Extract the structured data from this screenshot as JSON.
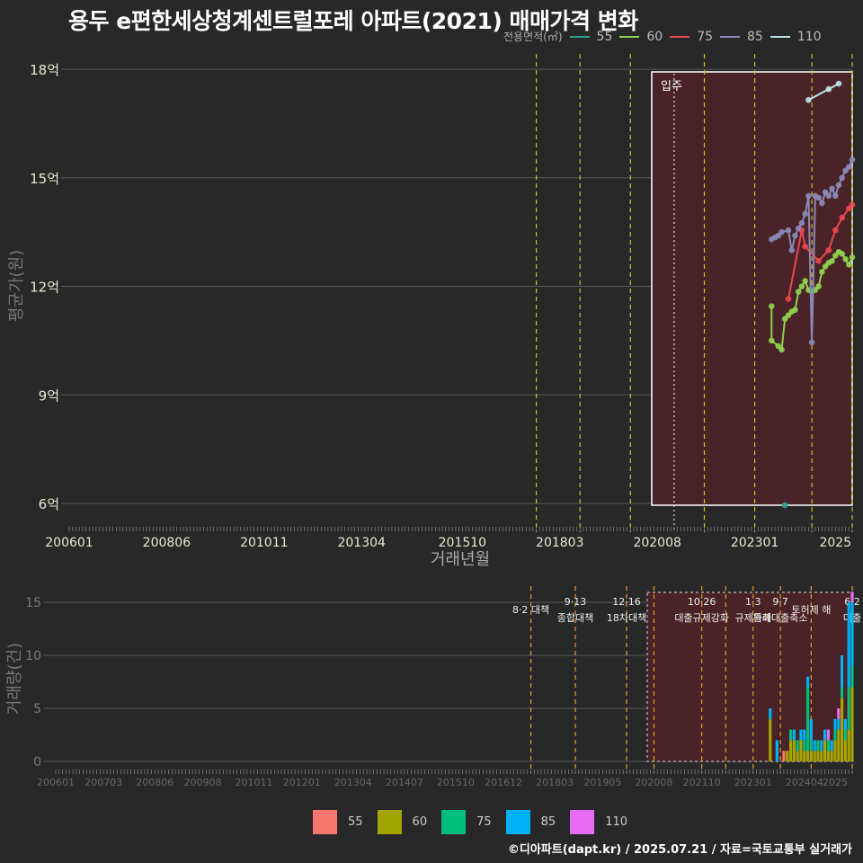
{
  "title": "용두 e편한세상청계센트럴포레 아파트(2021) 매매가격 변화",
  "footer": "©디아파트(dapt.kr) / 2025.07.21 / 자료=국토교통부 실거래가",
  "legend_title": "전용면적(㎡)",
  "legend": [
    {
      "name": "55",
      "line_color": "#2e9e96",
      "bar_color": "#f8766d"
    },
    {
      "name": "60",
      "line_color": "#8fd14f",
      "bar_color": "#a3a500"
    },
    {
      "name": "75",
      "line_color": "#e8484e",
      "bar_color": "#00bf7d"
    },
    {
      "name": "85",
      "line_color": "#8a89b8",
      "bar_color": "#00b0f6"
    },
    {
      "name": "110",
      "line_color": "#bde3ea",
      "bar_color": "#e76bf3"
    }
  ],
  "chart_data": [
    {
      "type": "line",
      "title": "용두 e편한세상청계센트럴포레 아파트(2021) 매매가격 변화",
      "xlabel": "거래년월",
      "ylabel": "평균가(원)",
      "x_ticks": [
        "200601",
        "200806",
        "201011",
        "201304",
        "201510",
        "201803",
        "202008",
        "202301",
        "2025"
      ],
      "y_ticks": [
        {
          "value": 6,
          "label": "6억"
        },
        {
          "value": 9,
          "label": "9억"
        },
        {
          "value": 12,
          "label": "12억"
        },
        {
          "value": 15,
          "label": "15억"
        },
        {
          "value": 18,
          "label": "18억"
        }
      ],
      "ylim": [
        5.6,
        18.4
      ],
      "grid": true,
      "shaded_period": {
        "start": "202012",
        "end": "2025",
        "label": "입주"
      },
      "policy_lines": [
        "201708",
        "201809",
        "201912",
        "202110",
        "202301",
        "202406",
        "202506"
      ],
      "move_in_line": "202101",
      "series": [
        {
          "name": "55",
          "points": [
            [
              "202310",
              5.95
            ]
          ]
        },
        {
          "name": "60",
          "points": [
            [
              "202306",
              11.45
            ],
            [
              "202306",
              10.5
            ],
            [
              "202308",
              10.35
            ],
            [
              "202309",
              10.25
            ],
            [
              "202310",
              11.1
            ],
            [
              "202311",
              11.2
            ],
            [
              "202312",
              11.3
            ],
            [
              "202401",
              11.35
            ],
            [
              "202402",
              11.85
            ],
            [
              "202403",
              12.0
            ],
            [
              "202404",
              12.15
            ],
            [
              "202405",
              11.9
            ],
            [
              "202406",
              11.85
            ],
            [
              "202407",
              11.9
            ],
            [
              "202408",
              12.0
            ],
            [
              "202409",
              12.4
            ],
            [
              "202410",
              12.55
            ],
            [
              "202411",
              12.65
            ],
            [
              "202412",
              12.7
            ],
            [
              "202501",
              12.85
            ],
            [
              "202502",
              12.95
            ],
            [
              "202503",
              12.9
            ],
            [
              "202504",
              12.75
            ],
            [
              "202505",
              12.6
            ],
            [
              "202506",
              12.8
            ]
          ]
        },
        {
          "name": "75",
          "points": [
            [
              "202311",
              11.65
            ],
            [
              "202403",
              13.55
            ],
            [
              "202404",
              13.1
            ],
            [
              "202408",
              12.7
            ],
            [
              "202411",
              13.0
            ],
            [
              "202501",
              13.55
            ],
            [
              "202503",
              13.9
            ],
            [
              "202505",
              14.15
            ],
            [
              "202506",
              14.25
            ]
          ]
        },
        {
          "name": "85",
          "points": [
            [
              "202306",
              13.3
            ],
            [
              "202307",
              13.35
            ],
            [
              "202308",
              13.4
            ],
            [
              "202309",
              13.5
            ],
            [
              "202311",
              13.55
            ],
            [
              "202312",
              13.0
            ],
            [
              "202401",
              13.4
            ],
            [
              "202402",
              13.6
            ],
            [
              "202403",
              13.75
            ],
            [
              "202404",
              14.0
            ],
            [
              "202405",
              14.5
            ],
            [
              "202406",
              10.45
            ],
            [
              "202407",
              14.5
            ],
            [
              "202408",
              14.45
            ],
            [
              "202409",
              14.3
            ],
            [
              "202410",
              14.6
            ],
            [
              "202411",
              14.5
            ],
            [
              "202412",
              14.7
            ],
            [
              "202501",
              14.5
            ],
            [
              "202502",
              14.8
            ],
            [
              "202503",
              15.0
            ],
            [
              "202504",
              15.2
            ],
            [
              "202505",
              15.3
            ],
            [
              "202506",
              15.5
            ]
          ]
        },
        {
          "name": "110",
          "points": [
            [
              "202405",
              17.15
            ],
            [
              "202411",
              17.45
            ],
            [
              "202502",
              17.6
            ]
          ]
        }
      ]
    },
    {
      "type": "bar",
      "ylabel": "거래량(건)",
      "x_ticks": [
        "200601",
        "200703",
        "200806",
        "200908",
        "201011",
        "201201",
        "201304",
        "201407",
        "201510",
        "201612",
        "201803",
        "201905",
        "202008",
        "202110",
        "202301",
        "202404",
        "2025"
      ],
      "y_ticks": [
        0,
        5,
        10,
        15
      ],
      "ylim": [
        -0.5,
        16.5
      ],
      "shaded_period": {
        "start": "202011",
        "end": "2025"
      },
      "policy_lines": [
        {
          "x": "201708",
          "label_top": "",
          "label_bottom": "8·2 대책"
        },
        {
          "x": "201809",
          "label_top": "9·13",
          "label_bottom": "종합대책"
        },
        {
          "x": "201912",
          "label_top": "12·16",
          "label_bottom": "18차대책"
        },
        {
          "x": "202008",
          "label_top": "",
          "label_bottom": ""
        },
        {
          "x": "202110",
          "label_top": "10·26",
          "label_bottom": "대출규제강화"
        },
        {
          "x": "202205",
          "label_top": "",
          "label_bottom": ""
        },
        {
          "x": "202301",
          "label_top": "1·3",
          "label_bottom": "규제완화"
        },
        {
          "x": "202309",
          "label_top": "9·7",
          "label_bottom": "특례대출축소"
        },
        {
          "x": "202406",
          "label_top": "",
          "label_bottom": "토허제 해"
        },
        {
          "x": "202506",
          "label_top": "6·2",
          "label_bottom": "대출"
        }
      ],
      "series_bars": [
        {
          "x": "202306",
          "55": 0,
          "60": 4,
          "75": 0,
          "85": 1,
          "110": 0
        },
        {
          "x": "202308",
          "55": 0,
          "60": 0,
          "75": 0,
          "85": 2,
          "110": 0
        },
        {
          "x": "202310",
          "55": 1,
          "60": 0,
          "75": 0,
          "85": 0,
          "110": 0
        },
        {
          "x": "202311",
          "55": 0,
          "60": 1,
          "75": 0,
          "85": 0,
          "110": 0
        },
        {
          "x": "202312",
          "55": 0,
          "60": 2,
          "75": 1,
          "85": 0,
          "110": 0
        },
        {
          "x": "202401",
          "55": 0,
          "60": 2,
          "75": 0,
          "85": 1,
          "110": 0
        },
        {
          "x": "202402",
          "55": 0,
          "60": 1,
          "75": 1,
          "85": 0,
          "110": 0
        },
        {
          "x": "202403",
          "55": 0,
          "60": 2,
          "75": 0,
          "85": 1,
          "110": 0
        },
        {
          "x": "202404",
          "55": 0,
          "60": 1,
          "75": 1,
          "85": 1,
          "110": 0
        },
        {
          "x": "202405",
          "55": 0,
          "60": 1,
          "75": 6,
          "85": 1,
          "110": 0
        },
        {
          "x": "202406",
          "55": 0,
          "60": 1,
          "75": 1,
          "85": 2,
          "110": 0
        },
        {
          "x": "202407",
          "55": 0,
          "60": 1,
          "75": 0,
          "85": 1,
          "110": 0
        },
        {
          "x": "202408",
          "55": 0,
          "60": 1,
          "75": 1,
          "85": 0,
          "110": 0
        },
        {
          "x": "202409",
          "55": 0,
          "60": 1,
          "75": 0,
          "85": 1,
          "110": 0
        },
        {
          "x": "202410",
          "55": 0,
          "60": 2,
          "75": 0,
          "85": 1,
          "110": 0
        },
        {
          "x": "202411",
          "55": 0,
          "60": 1,
          "75": 1,
          "85": 0,
          "110": 1
        },
        {
          "x": "202412",
          "55": 0,
          "60": 1,
          "75": 0,
          "85": 1,
          "110": 0
        },
        {
          "x": "202501",
          "55": 0,
          "60": 2,
          "75": 1,
          "85": 1,
          "110": 0
        },
        {
          "x": "202502",
          "55": 0,
          "60": 3,
          "75": 0,
          "85": 1,
          "110": 1
        },
        {
          "x": "202503",
          "55": 0,
          "60": 6,
          "75": 1,
          "85": 3,
          "110": 0
        },
        {
          "x": "202504",
          "55": 0,
          "60": 2,
          "75": 1,
          "85": 1,
          "110": 0
        },
        {
          "x": "202505",
          "55": 0,
          "60": 3,
          "75": 4,
          "85": 8,
          "110": 0
        },
        {
          "x": "202506",
          "55": 0,
          "60": 7,
          "75": 2,
          "85": 6,
          "110": 1
        }
      ]
    }
  ]
}
